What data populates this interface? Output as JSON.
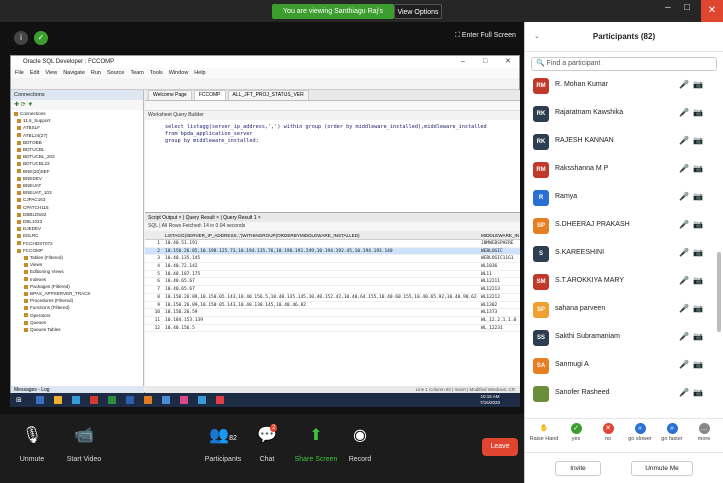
{
  "window": {
    "title_min": "–",
    "title_max": "□",
    "title_close": "✕"
  },
  "share": {
    "banner": "You are viewing Santhiagu Raj's screen",
    "view_options": "View Options ⌄",
    "enter_full_screen": "Enter Full Screen"
  },
  "sqldev": {
    "title": "Oracle SQL Developer : FCCOMP",
    "menu": [
      "File",
      "Edit",
      "View",
      "Navigate",
      "Run",
      "Source",
      "Team",
      "Tools",
      "Window",
      "Help"
    ],
    "connections_label": "Connections",
    "tree": [
      "Connections",
      "11.6_Support",
      "ATBSLF",
      "ATBL24(27)",
      "BDTOBB",
      "BDTUCBL",
      "BDTUCBL_203",
      "BDTUCBL23",
      "BNE(20)SEF",
      "BNEDEV",
      "BNEUAT",
      "BNEUAT_103",
      "CJPAC163",
      "CPATCH116",
      "DBBLD5S2",
      "DBL1023",
      "DJEDEV",
      "EDLRC",
      "FCCHDST072",
      "FCCOMP",
      "Tables (Filtered)",
      "Views",
      "Editioning Views",
      "Indexes",
      "Packages (Filtered)",
      "BPAS_APPSERVER_TRACK",
      "Procedures (Filtered)",
      "Functions (Filtered)",
      "Operators",
      "Queues",
      "Queues Tables"
    ],
    "messages_tab": "Messages - Log",
    "doc_tabs": [
      "Welcome Page",
      "FCCOMP",
      "ALL_JFT_PROJ_STATUS_VER"
    ],
    "worksheet_tabs": "Worksheet    Query Builder",
    "sql": [
      "select listagg(server_ip_address,',') within group (order by middleware_installed),middleware_installed",
      "from bpda_application_server",
      "group by middleware_installed;"
    ],
    "result_tabs": "Script Output × | Query Result × | Query Result 1 ×",
    "result_status": "SQL | All Rows Fetched: 14 in 0.04 seconds",
    "col1": "LISTAGG(SERVER_IP_ADDRESS,',')WITHINGROUP(ORDERBYMIDDLEWARE_INSTALLED)",
    "col2": "MIDDLEWARE_IN",
    "rows": [
      {
        "n": "1",
        "v": "10.40.51.191",
        "m": "JBMWEBSPHERE"
      },
      {
        "n": "2",
        "v": "10.150.26.85,10.198.125.73,10.194.135.76,10.196.191.249,10.194.192.45,10.194.193.140",
        "m": "WEBLOGIC"
      },
      {
        "n": "3",
        "v": "10.40.135.145",
        "m": "WEBLOGIC11G1"
      },
      {
        "n": "4",
        "v": "10.40.72.142",
        "m": "WL1036"
      },
      {
        "n": "5",
        "v": "10.40.187.175",
        "m": "WL11"
      },
      {
        "n": "6",
        "v": "10.40.65.67",
        "m": "WL12211"
      },
      {
        "n": "7",
        "v": "10.40.65.67",
        "m": "WL12213"
      },
      {
        "n": "8",
        "v": "10.150.26.89,10.150.05.143,10.40.156.5,10.40.135.145,10.40.152.42,10.40.64.155,10.40.60.155,10.40.65.92,10.40.90.62",
        "m": "WL12212"
      },
      {
        "n": "9",
        "v": "10.150.26.89,10.150.05.143,10.40.130.145,10.40.46.82",
        "m": "WL1302"
      },
      {
        "n": "10",
        "v": "10.150.26.59",
        "m": "WL1373"
      },
      {
        "n": "11",
        "v": "10.184.153.139",
        "m": "WL_12.2.1.1.0"
      },
      {
        "n": "12",
        "v": "10.40.156.5",
        "m": "WL_12231"
      }
    ],
    "status": "Line 1 Column 82   |  Insert   |  Modified  Windows: CR"
  },
  "taskbar": {
    "time": "10:15 AM",
    "date": "7/16/2020"
  },
  "controls": {
    "unmute": "Unmute",
    "start_video": "Start Video",
    "participants": "Participants",
    "participants_count": "82",
    "chat": "Chat",
    "chat_badge": "2",
    "share_screen": "Share Screen",
    "record": "Record",
    "leave": "Leave"
  },
  "panel": {
    "title": "Participants (82)",
    "search_placeholder": "Find a participant",
    "participants": [
      {
        "initials": "RM",
        "name": "R. Mohan Kumar",
        "color": "#c0392b"
      },
      {
        "initials": "RK",
        "name": "Rajaratnam Kawshika",
        "color": "#2c3e50"
      },
      {
        "initials": "RK",
        "name": "RAJESH KANNAN",
        "color": "#2c3e50"
      },
      {
        "initials": "RM",
        "name": "Raksshanna M P",
        "color": "#c0392b"
      },
      {
        "initials": "R",
        "name": "Ramya",
        "color": "#2a6fd6"
      },
      {
        "initials": "SP",
        "name": "S.DHEERAJ PRAKASH",
        "color": "#e67e22"
      },
      {
        "initials": "S",
        "name": "S.KAREESHINI",
        "color": "#2c3e50"
      },
      {
        "initials": "SM",
        "name": "S.T.AROKKIYA MARY",
        "color": "#c0392b"
      },
      {
        "initials": "SP",
        "name": "sahana parveen",
        "color": "#f0a030"
      },
      {
        "initials": "SS",
        "name": "Sakthi Subramaniam",
        "color": "#2c3e50"
      },
      {
        "initials": "SA",
        "name": "Sanmugi A",
        "color": "#e67e22"
      },
      {
        "initials": "",
        "name": "Sanofer Rasheed",
        "color": "#6b8e3a"
      }
    ],
    "reactions": [
      "Raise Hand",
      "yes",
      "no",
      "go slower",
      "go faster",
      "more"
    ],
    "invite": "Invite",
    "unmute_me": "Unmute Me"
  }
}
